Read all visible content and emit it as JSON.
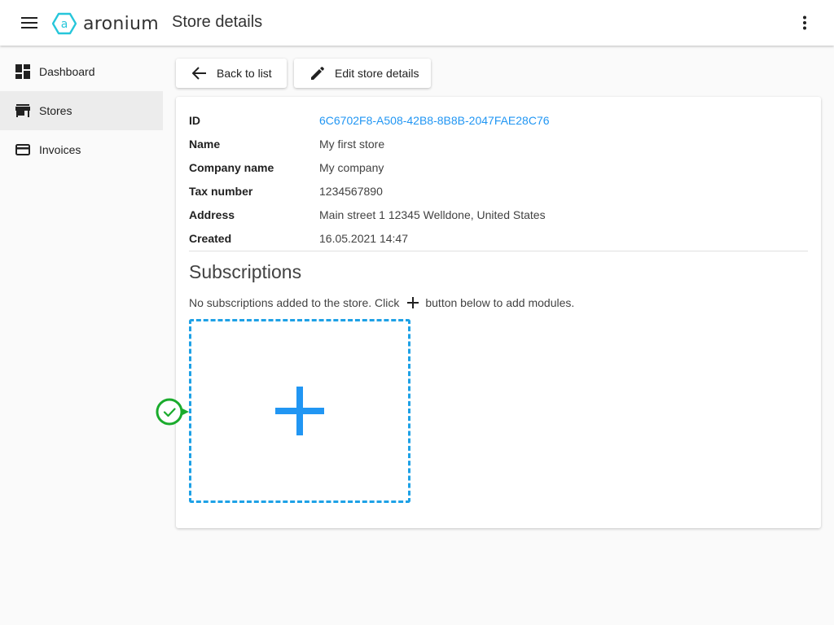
{
  "app": {
    "logo_text": "aronium",
    "page_title": "Store details"
  },
  "colors": {
    "accent": "#2196f3",
    "logo": "#26c6da",
    "dashed_border": "#1ea1e6",
    "indicator": "#1aab2c"
  },
  "sidebar": {
    "items": [
      {
        "label": "Dashboard",
        "icon": "dashboard-icon"
      },
      {
        "label": "Stores",
        "icon": "store-icon",
        "active": true
      },
      {
        "label": "Invoices",
        "icon": "credit-card-icon"
      }
    ]
  },
  "toolbar": {
    "back_label": "Back to list",
    "edit_label": "Edit store details"
  },
  "details": {
    "rows": [
      {
        "label": "ID",
        "value": "6C6702F8-A508-42B8-8B8B-2047FAE28C76"
      },
      {
        "label": "Name",
        "value": "My first store"
      },
      {
        "label": "Company name",
        "value": "My company"
      },
      {
        "label": "Tax number",
        "value": "1234567890"
      },
      {
        "label": "Address",
        "value": "Main street 1 12345 Welldone, United States"
      },
      {
        "label": "Created",
        "value": "16.05.2021 14:47"
      }
    ]
  },
  "subscriptions": {
    "title": "Subscriptions",
    "note_before": "No subscriptions added to the store. Click",
    "note_after": "button below to add modules."
  }
}
